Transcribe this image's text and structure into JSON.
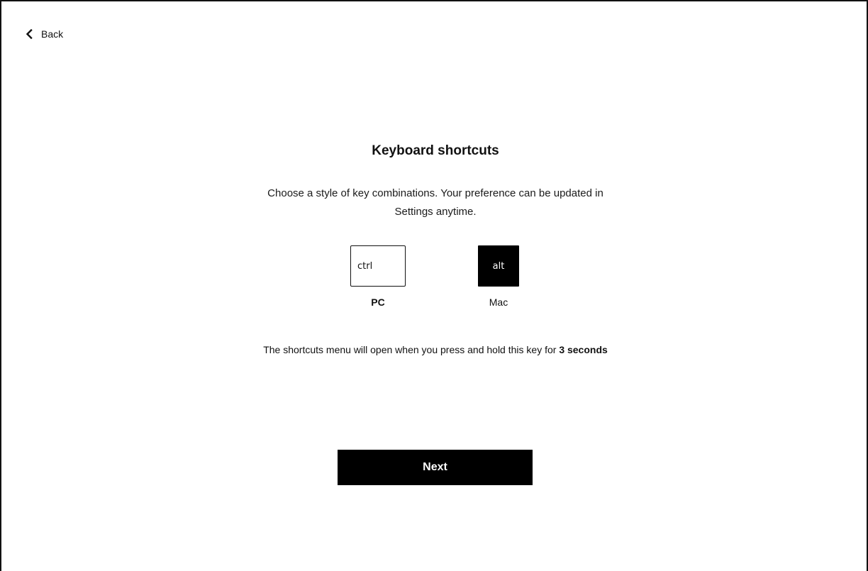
{
  "nav": {
    "back_label": "Back"
  },
  "main": {
    "title": "Keyboard shortcuts",
    "description": "Choose a style of key combinations. Your preference can be updated in Settings anytime.",
    "options": [
      {
        "key": "ctrl",
        "label": "PC",
        "selected": false
      },
      {
        "key": "alt",
        "label": "Mac",
        "selected": true
      }
    ],
    "hint_text": "The shortcuts menu will open when you press and hold this key for ",
    "hint_emphasis": "3 seconds",
    "next_label": "Next"
  },
  "colors": {
    "primary": "#000000",
    "text": "#111111",
    "background": "#ffffff"
  },
  "icons": {
    "back": "chevron-left-icon"
  }
}
